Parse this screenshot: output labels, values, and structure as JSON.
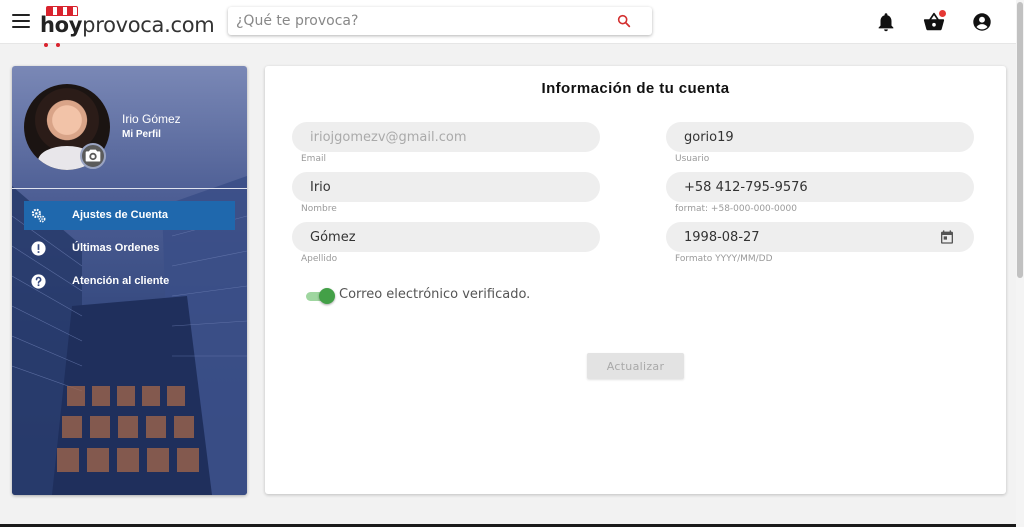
{
  "header": {
    "logo_hoy": "hoy",
    "logo_rest": "provoca.com",
    "search_placeholder": "¿Qué te provoca?",
    "icons": [
      "menu-icon",
      "search-icon",
      "bell-icon",
      "basket-icon",
      "account-circle-icon"
    ],
    "cart_badge_color": "#e53935"
  },
  "sidebar": {
    "user_name": "Irio Gómez",
    "user_subtitle": "Mi Perfil",
    "items": [
      {
        "label": "Ajustes de Cuenta",
        "icon": "cog-icon",
        "active": true
      },
      {
        "label": "Últimas Ordenes",
        "icon": "alert-circle-icon",
        "active": false
      },
      {
        "label": "Atención al cliente",
        "icon": "help-circle-icon",
        "active": false
      }
    ],
    "active_color": "#1f68ad"
  },
  "form": {
    "title": "Información de tu cuenta",
    "email": {
      "value": "iriojgomezv@gmail.com",
      "label": "Email"
    },
    "username": {
      "value": "gorio19",
      "label": "Usuario"
    },
    "first_name": {
      "value": "Irio",
      "label": "Nombre"
    },
    "phone": {
      "value": "+58 412-795-9576",
      "label": "format: +58-000-000-0000"
    },
    "last_name": {
      "value": "Gómez",
      "label": "Apellido"
    },
    "birthdate": {
      "value": "1998-08-27",
      "label": "Formato YYYY/MM/DD"
    },
    "email_verified": {
      "label": "Correo electrónico verificado.",
      "on": true,
      "color": "#43a047"
    },
    "submit_label": "Actualizar"
  }
}
